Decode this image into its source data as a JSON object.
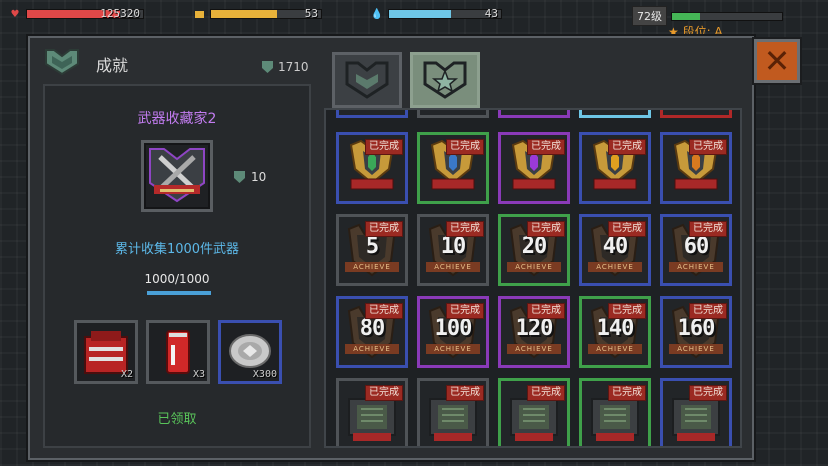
{
  "hud": {
    "health": {
      "value": "125320",
      "fill": 0.8,
      "color": "#e04848"
    },
    "energy": {
      "value": "53",
      "fill": 0.6,
      "color": "#e8b23a"
    },
    "water": {
      "value": "43",
      "fill": 0.55,
      "color": "#6ec6e6"
    },
    "level_label": "72级",
    "xp_fill": 0.25,
    "rank_label": "段位: A"
  },
  "panel": {
    "title": "成就",
    "currency": "1710",
    "close_icon": "close-icon"
  },
  "detail": {
    "name": "武器收藏家2",
    "reward_amount": "10",
    "description": "累计收集1000件武器",
    "progress_text": "1000/1000",
    "progress": 1.0,
    "rewards": [
      {
        "icon": "ammo-crate-icon",
        "qty": "X2"
      },
      {
        "icon": "soda-can-icon",
        "qty": "X3"
      },
      {
        "icon": "silver-coin-icon",
        "qty": "X300"
      }
    ],
    "status": "已领取"
  },
  "tabs": [
    {
      "icon": "shield-badge-icon",
      "active": false
    },
    {
      "icon": "star-shield-icon",
      "active": true
    }
  ],
  "grid": {
    "done_label": "已完成",
    "achieve_label": "ACHIEVE",
    "rows": [
      {
        "type": "emblem",
        "cells": [
          {
            "border": "#3a4fb0",
            "gem": "#3aa858"
          },
          {
            "border": "#3fa04a",
            "gem": "#3a78c8"
          },
          {
            "border": "#8a3ab8",
            "gem": "#9a3ad8"
          },
          {
            "border": "#3a4fb0",
            "gem": "#e0a020"
          },
          {
            "border": "#3a4fb0",
            "gem": "#d87a20"
          }
        ]
      },
      {
        "type": "number",
        "cells": [
          {
            "border": "#4f5357",
            "num": "5"
          },
          {
            "border": "#4f5357",
            "num": "10"
          },
          {
            "border": "#3fa04a",
            "num": "20"
          },
          {
            "border": "#3a4fb0",
            "num": "40"
          },
          {
            "border": "#3a4fb0",
            "num": "60"
          }
        ]
      },
      {
        "type": "number",
        "cells": [
          {
            "border": "#3a4fb0",
            "num": "80"
          },
          {
            "border": "#8a3ab8",
            "num": "100"
          },
          {
            "border": "#8a3ab8",
            "num": "120"
          },
          {
            "border": "#3fa04a",
            "num": "140"
          },
          {
            "border": "#3a4fb0",
            "num": "160"
          }
        ]
      },
      {
        "type": "vault",
        "cells": [
          {
            "border": "#4f5357"
          },
          {
            "border": "#4f5357"
          },
          {
            "border": "#3fa04a"
          },
          {
            "border": "#3fa04a"
          },
          {
            "border": "#3a4fb0"
          }
        ]
      }
    ]
  }
}
